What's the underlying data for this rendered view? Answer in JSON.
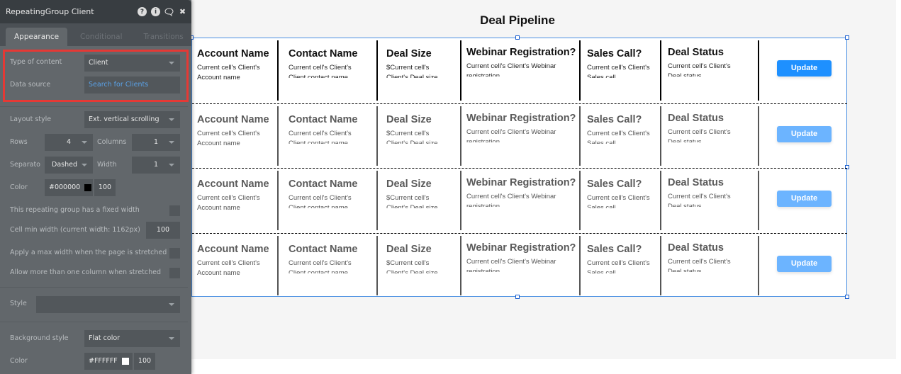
{
  "page": {
    "title": "Deal Pipeline"
  },
  "panel": {
    "title": "RepeatingGroup Client",
    "header_icons": [
      "help-icon",
      "info-icon",
      "comment-icon",
      "close-icon"
    ],
    "tabs": [
      {
        "label": "Appearance",
        "active": true
      },
      {
        "label": "Conditional",
        "active": false
      },
      {
        "label": "Transitions",
        "active": false
      }
    ],
    "type_of_content": {
      "label": "Type of content",
      "value": "Client"
    },
    "data_source": {
      "label": "Data source",
      "value": "Search for Clients"
    },
    "layout_style": {
      "label": "Layout style",
      "value": "Ext. vertical scrolling"
    },
    "rows": {
      "label": "Rows",
      "value": "4"
    },
    "columns": {
      "label": "Columns",
      "value": "1"
    },
    "separator": {
      "label": "Separato",
      "value": "Dashed"
    },
    "width": {
      "label": "Width",
      "value": "1"
    },
    "separator_color": {
      "label": "Color",
      "hex": "#000000",
      "opacity": "100"
    },
    "fixed_width": {
      "label": "This repeating group has a fixed width",
      "checked": false
    },
    "cell_min_width": {
      "label": "Cell min width (current width: 1162px)",
      "value": "100"
    },
    "max_width": {
      "label": "Apply a max width when the page is stretched",
      "checked": false
    },
    "multi_column": {
      "label": "Allow more than one column when stretched",
      "checked": false
    },
    "style": {
      "label": "Style",
      "value": ""
    },
    "background_style": {
      "label": "Background style",
      "value": "Flat color"
    },
    "background_color": {
      "label": "Color",
      "hex": "#FFFFFF",
      "opacity": "100"
    }
  },
  "repeating_group": {
    "columns": [
      {
        "heading": "Account Name",
        "text": "Current cell's Client's Account name"
      },
      {
        "heading": "Contact Name",
        "text": "Current cell's Client's Client contact name"
      },
      {
        "heading": "Deal Size",
        "text": "$Current cell's Client's Deal size"
      },
      {
        "heading": "Webinar Registration?",
        "text": "Current cell's Client's Webinar registration"
      },
      {
        "heading": "Sales Call?",
        "text": "Current cell's Client's Sales call"
      },
      {
        "heading": "Deal Status",
        "text": "Current cell's Client's Deal status"
      }
    ],
    "button_label": "Update",
    "row_count": 4,
    "colors": {
      "button": "#1e90ff",
      "button_faded": "#6cb4ff",
      "selection": "#4a90e2"
    }
  }
}
